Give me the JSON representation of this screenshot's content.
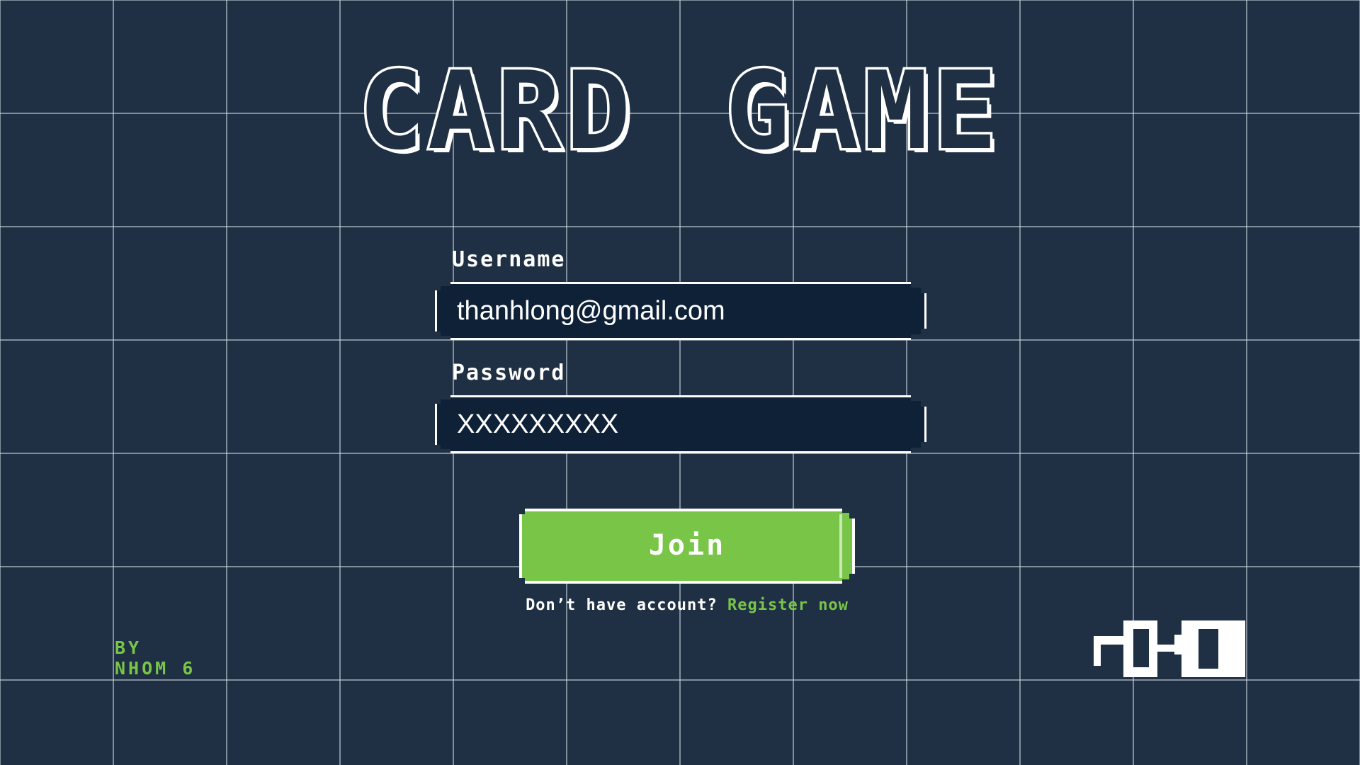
{
  "title": {
    "text": "CARD GAME"
  },
  "login_form": {
    "username": {
      "label": "Username",
      "value": "thanhlong@gmail.com"
    },
    "password": {
      "label": "Password",
      "value": "XXXXXXXXX"
    },
    "join_button": {
      "label": "Join"
    },
    "register_prompt": {
      "text": "Don’t have account?",
      "link_label": "Register now"
    }
  },
  "credit": {
    "line1": "BY",
    "line2": "NHOM 6"
  },
  "colors": {
    "background": "#1f3044",
    "field": "#0e2137",
    "accent_green": "#78c548",
    "text": "#ffffff"
  }
}
